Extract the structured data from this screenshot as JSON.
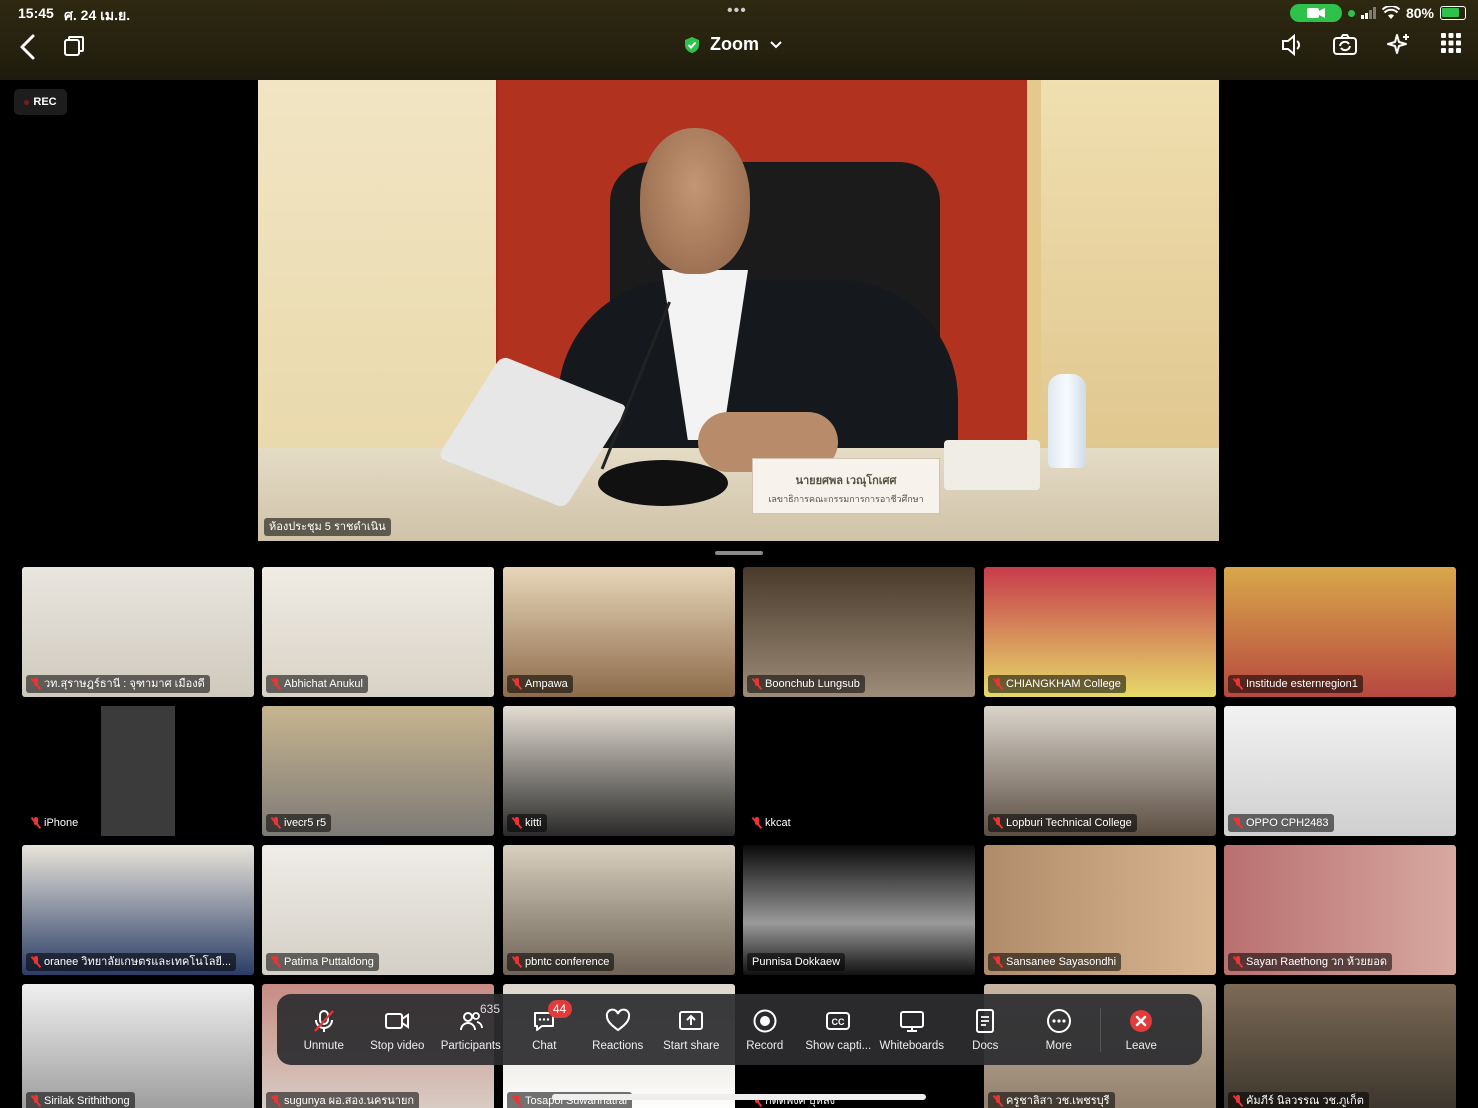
{
  "status_bar": {
    "time": "15:45",
    "date": "ศ. 24 เม.ย.",
    "battery": "80%"
  },
  "header": {
    "title": "Zoom"
  },
  "recording": {
    "label": "REC"
  },
  "speaker": {
    "room_label": "ห้องประชุม 5 ราชดำเนิน",
    "nameplate_line1": "นายยศพล เวณุโกเศศ",
    "nameplate_line2": "เลขาธิการคณะกรรมการการอาชีวศึกษา"
  },
  "participants": [
    {
      "name": "วท.สุราษฎร์ธานี : จุฑามาศ เมืองดี",
      "muted": true
    },
    {
      "name": "Abhichat Anukul",
      "muted": true
    },
    {
      "name": "Ampawa",
      "muted": true
    },
    {
      "name": "Boonchub Lungsub",
      "muted": true
    },
    {
      "name": "CHIANGKHAM College",
      "muted": true
    },
    {
      "name": "Institude esternregion1",
      "muted": true
    },
    {
      "name": "iPhone",
      "muted": true
    },
    {
      "name": "ivecr5 r5",
      "muted": true
    },
    {
      "name": "kitti",
      "muted": true
    },
    {
      "name": "kkcat",
      "muted": true
    },
    {
      "name": "Lopburi Technical College",
      "muted": true
    },
    {
      "name": "OPPO CPH2483",
      "muted": true
    },
    {
      "name": "oranee วิทยาลัยเกษตรและเทคโนโลยี...",
      "muted": true
    },
    {
      "name": "Patima Puttaldong",
      "muted": true
    },
    {
      "name": "pbntc conference",
      "muted": true
    },
    {
      "name": "Punnisa Dokkaew",
      "muted": false
    },
    {
      "name": "Sansanee Sayasondhi",
      "muted": true
    },
    {
      "name": "Sayan Raethong วก ห้วยยอด",
      "muted": true
    },
    {
      "name": "Sirilak Srithithong",
      "muted": true
    },
    {
      "name": "sugunya ผอ.สอง.นครนายก",
      "muted": true
    },
    {
      "name": "Tosapol Suwannatrai",
      "muted": true
    },
    {
      "name": "กิตติพงศ์ บุหลง",
      "muted": true
    },
    {
      "name": "ครูชาลิสา วช.เพชรบุรี",
      "muted": true
    },
    {
      "name": "คัมภีร์ นิลวรรณ วช.ภูเก็ต",
      "muted": true
    }
  ],
  "toolbar": {
    "unmute": "Unmute",
    "stop_video": "Stop video",
    "participants": "Participants",
    "participants_count": "635",
    "chat": "Chat",
    "chat_badge": "44",
    "reactions": "Reactions",
    "start_share": "Start share",
    "record": "Record",
    "captions": "Show capti...",
    "whiteboards": "Whiteboards",
    "docs": "Docs",
    "more": "More",
    "leave": "Leave"
  },
  "colors": {
    "accent_green": "#2ec24a",
    "leave_red": "#e23b3b",
    "muted_red": "#e33333"
  }
}
